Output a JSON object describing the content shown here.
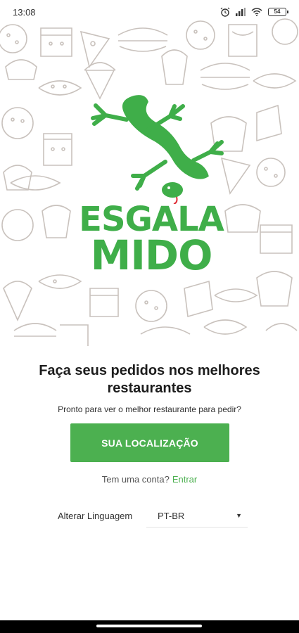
{
  "status_bar": {
    "time": "13:08",
    "battery": "54"
  },
  "logo": {
    "line1": "ESGALA",
    "line2": "MIDO"
  },
  "headline": "Faça seus pedidos nos melhores restaurantes",
  "subtext": "Pronto para ver o melhor restaurante para pedir?",
  "cta_label": "SUA LOCALIZAÇÃO",
  "account": {
    "prompt": "Tem uma conta?",
    "link": "Entrar"
  },
  "language": {
    "label": "Alterar Linguagem",
    "selected": "PT-BR"
  },
  "colors": {
    "brand_green": "#4cb050",
    "logo_green": "#3fae49",
    "pattern_line": "#c9c2bd"
  },
  "icons": [
    "alarm-icon",
    "signal-icon",
    "wifi-icon",
    "battery-icon",
    "gecko-mascot-icon",
    "dropdown-caret-icon"
  ]
}
